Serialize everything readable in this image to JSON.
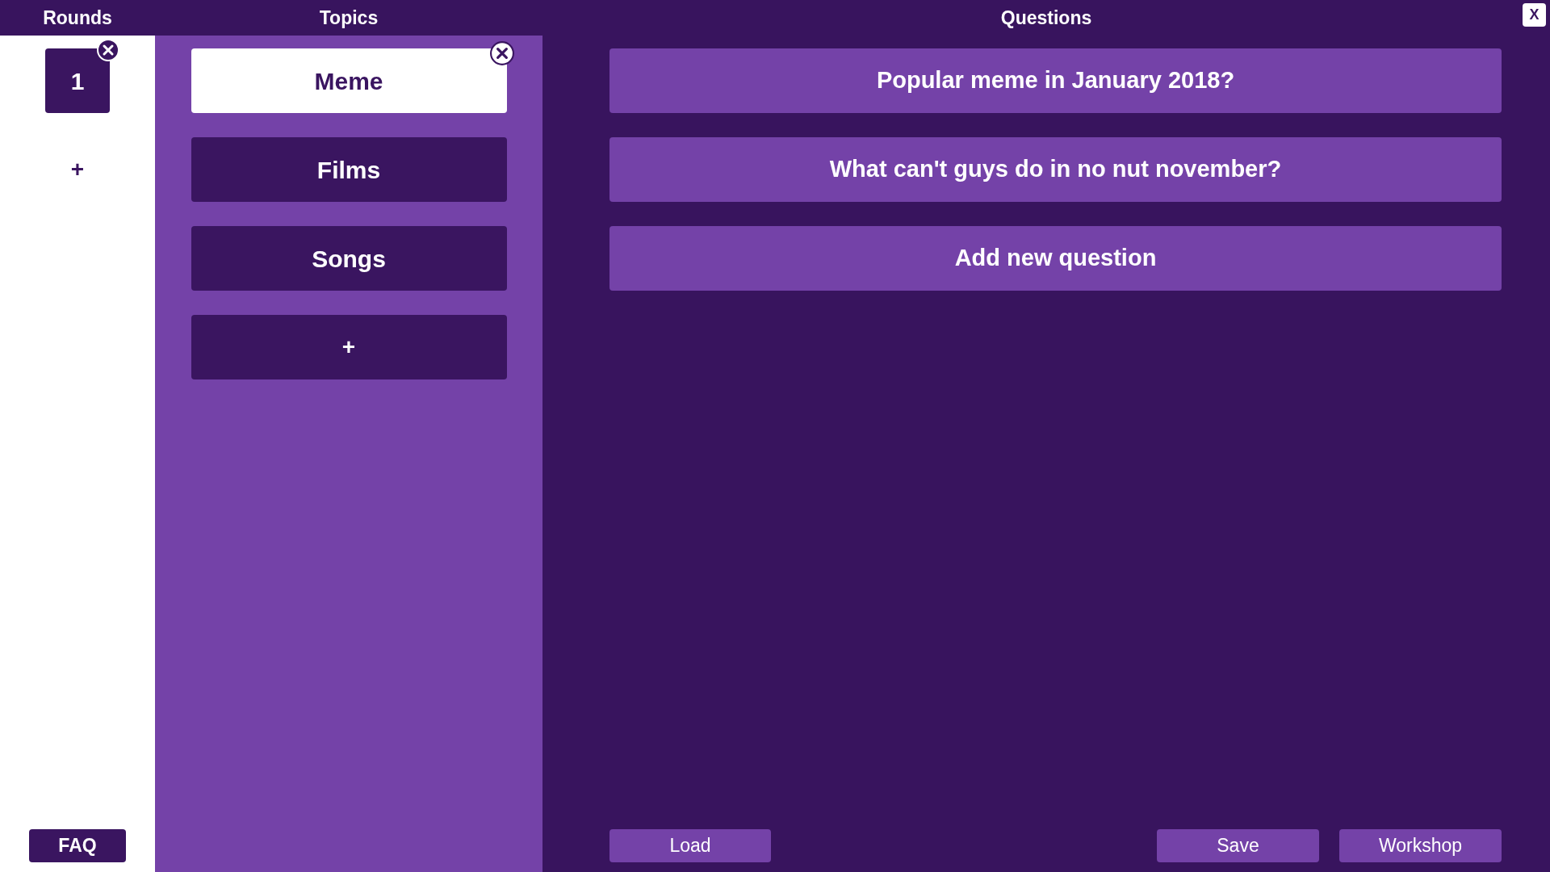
{
  "close_button": "X",
  "rounds": {
    "title": "Rounds",
    "items": [
      {
        "label": "1",
        "selected": true
      }
    ],
    "add_button": "+",
    "faq_button": "FAQ"
  },
  "topics": {
    "title": "Topics",
    "items": [
      {
        "label": "Meme",
        "selected": true
      },
      {
        "label": "Films",
        "selected": false
      },
      {
        "label": "Songs",
        "selected": false
      }
    ],
    "add_button": "+"
  },
  "questions": {
    "title": "Questions",
    "items": [
      {
        "text": "Popular meme in January 2018?"
      },
      {
        "text": "What can't guys do in no nut november?"
      }
    ],
    "add_button": "Add new question"
  },
  "footer": {
    "left": [
      {
        "label": "Load"
      }
    ],
    "right": [
      {
        "label": "Save"
      },
      {
        "label": "Workshop"
      }
    ]
  }
}
